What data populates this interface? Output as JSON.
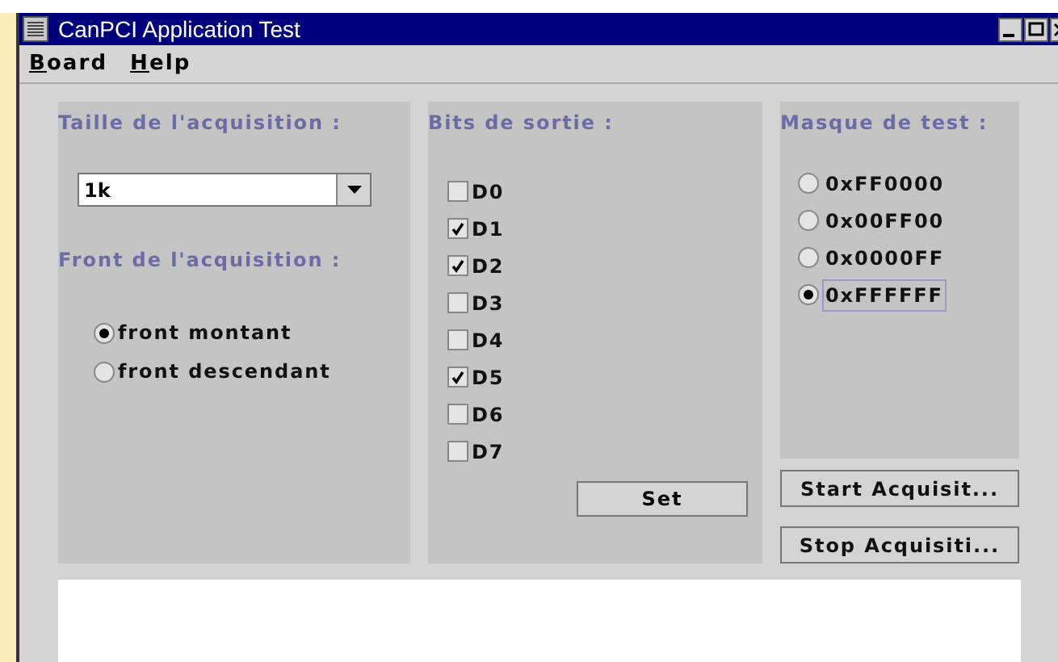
{
  "window": {
    "title": "CanPCI Application Test"
  },
  "menu": [
    "Board",
    "Help"
  ],
  "acquisition_size": {
    "title": "Taille de l'acquisition :",
    "value": "1k"
  },
  "acquisition_edge": {
    "title": "Front de l'acquisition :",
    "options": [
      {
        "label": "front montant",
        "selected": true
      },
      {
        "label": "front descendant",
        "selected": false
      }
    ]
  },
  "output_bits": {
    "title": "Bits de sortie :",
    "bits": [
      {
        "label": "D0",
        "checked": false
      },
      {
        "label": "D1",
        "checked": true
      },
      {
        "label": "D2",
        "checked": true
      },
      {
        "label": "D3",
        "checked": false
      },
      {
        "label": "D4",
        "checked": false
      },
      {
        "label": "D5",
        "checked": true
      },
      {
        "label": "D6",
        "checked": false
      },
      {
        "label": "D7",
        "checked": false
      }
    ],
    "button": "Set"
  },
  "test_mask": {
    "title": "Masque de test :",
    "options": [
      {
        "label": "0xFF0000",
        "selected": false
      },
      {
        "label": "0x00FF00",
        "selected": false
      },
      {
        "label": "0x0000FF",
        "selected": false
      },
      {
        "label": "0xFFFFFF",
        "selected": true
      }
    ]
  },
  "buttons": [
    "Start Acquisit...",
    "Stop Acquisiti..."
  ]
}
